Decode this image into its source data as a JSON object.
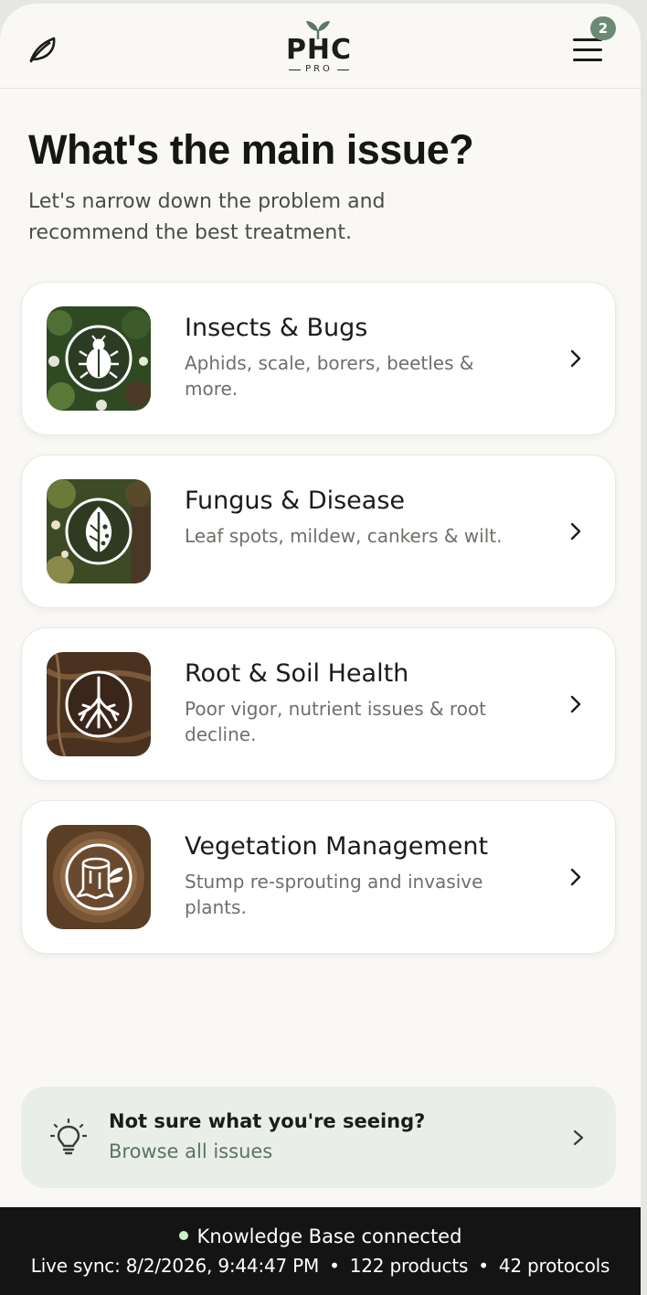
{
  "header": {
    "logo_text": "PHC",
    "logo_sub": "PRO",
    "menu_badge": "2"
  },
  "page": {
    "title": "What's the main issue?",
    "subtitle": "Let's narrow down the problem and recommend the best treatment."
  },
  "issues": [
    {
      "title": "Insects & Bugs",
      "description": "Aphids, scale, borers, beetles & more.",
      "icon": "beetle-icon"
    },
    {
      "title": "Fungus & Disease",
      "description": "Leaf spots, mildew, cankers & wilt.",
      "icon": "spotted-leaf-icon"
    },
    {
      "title": "Root & Soil Health",
      "description": "Poor vigor, nutrient issues & root decline.",
      "icon": "roots-icon"
    },
    {
      "title": "Vegetation Management",
      "description": "Stump re-sprouting and invasive plants.",
      "icon": "stump-sprout-icon"
    }
  ],
  "help": {
    "title": "Not sure what you're seeing?",
    "link": "Browse all issues"
  },
  "status": {
    "connection": "Knowledge Base connected",
    "sync": "Live sync: 8/2/2026, 9:44:47 PM",
    "products": "122 products",
    "protocols": "42 protocols",
    "separator": "•"
  },
  "colors": {
    "background": "#f9f8f4",
    "accent_green": "#6a8a73",
    "help_bg": "#eaeee8",
    "status_bar": "#141414",
    "status_dot": "#c7f0c4"
  }
}
